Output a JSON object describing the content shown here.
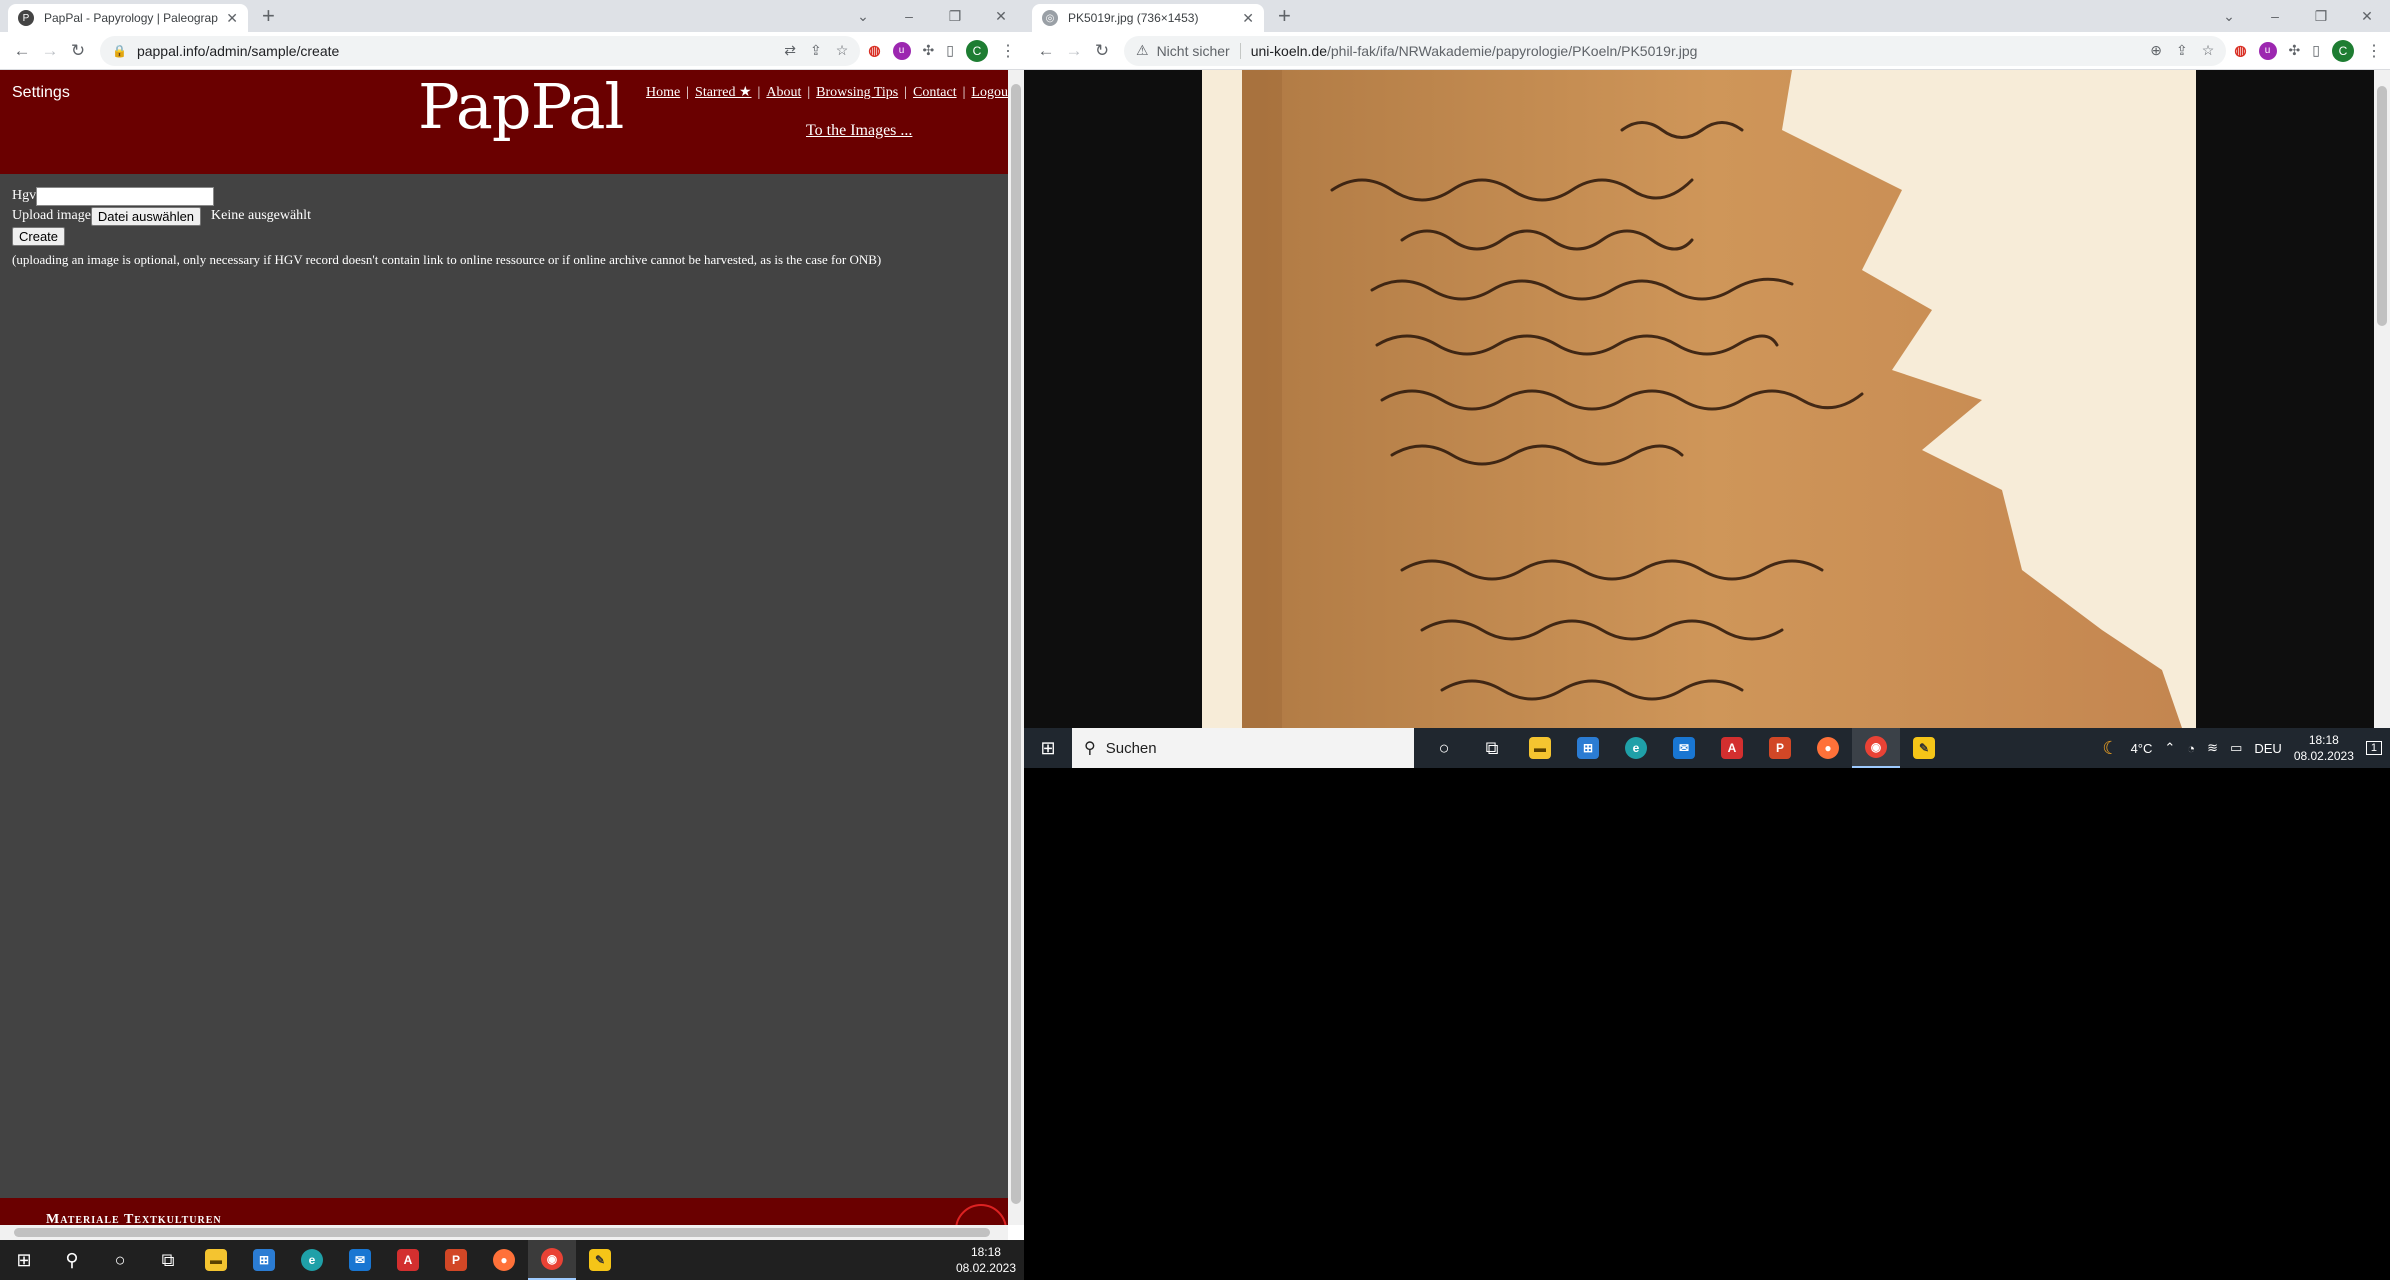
{
  "left_browser": {
    "tab_title": "PapPal - Papyrology | Paleography",
    "tab_favicon": "P",
    "url": "pappal.info/admin/sample/create",
    "extensions": [
      "translate-icon",
      "share-icon",
      "star-icon",
      "adblock-icon",
      "extension-ub-icon",
      "puzzle-icon",
      "sidebar-icon"
    ],
    "profile_initial": "C"
  },
  "pappal": {
    "settings": "Settings",
    "logo": "PapPal",
    "nav": [
      "Home",
      "Starred ★",
      "About",
      "Browsing Tips",
      "Contact",
      "Logout"
    ],
    "to_images": "To the Images ...",
    "hgv_label": "Hgv",
    "upload_label": "Upload image",
    "file_button": "Datei auswählen",
    "no_file": "Keine ausgewählt",
    "create_button": "Create",
    "note": "(uploading an image is optional, only necessary if HGV record doesn't contain link to online ressource or if online archive cannot be harvested, as is the case for ONB)",
    "footer_text": "Materiale Textkulturen"
  },
  "right_browser": {
    "tab_title": "PK5019r.jpg (736×1453)",
    "not_secure": "Nicht sicher",
    "url_host": "uni-koeln.de",
    "url_path": "/phil-fak/ifa/NRWakademie/papyrologie/PKoeln/PK5019r.jpg",
    "profile_initial": "C"
  },
  "taskbar_left": {
    "time": "18:18",
    "date": "08.02.2023"
  },
  "taskbar_right": {
    "search_placeholder": "Suchen",
    "weather": "4°C",
    "lang": "DEU",
    "time": "18:18",
    "date": "08.02.2023",
    "notifications": "1"
  },
  "colors": {
    "pappal_red": "#6a0000",
    "page_bg": "#434343",
    "papyrus": "#c58a4e"
  }
}
